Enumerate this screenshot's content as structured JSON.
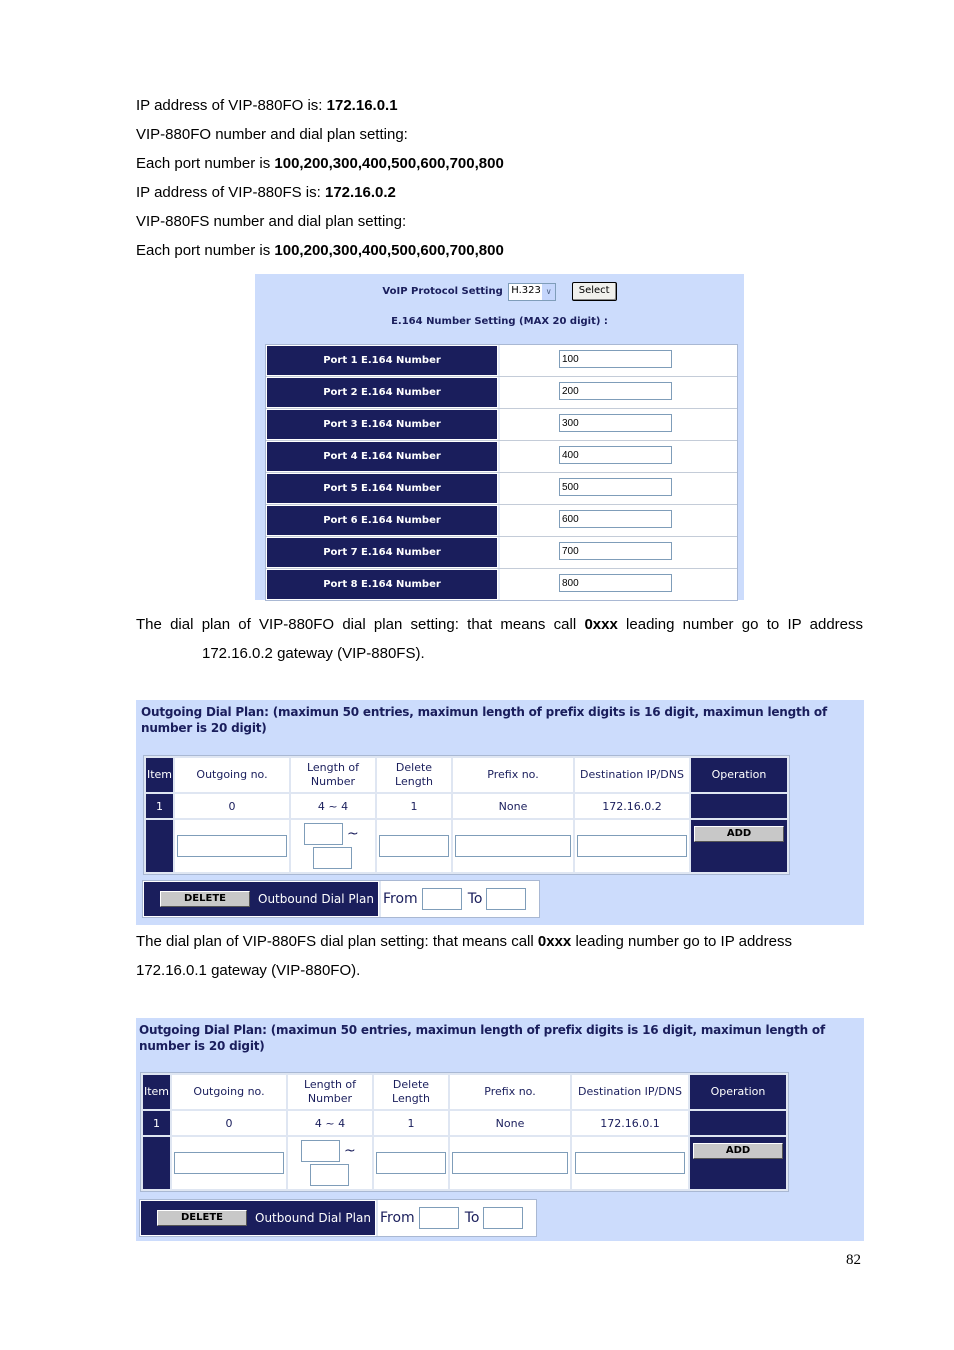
{
  "intro": [
    {
      "text": "IP address of VIP-880FO is: ",
      "bold": "172.16.0.1"
    },
    {
      "text": "VIP-880FO number and dial plan setting:",
      "bold": ""
    },
    {
      "text": "Each port number is ",
      "bold": "100,200,300,400,500,600,700,800"
    },
    {
      "text": "IP address of VIP-880FS is: ",
      "bold": "172.16.0.2"
    },
    {
      "text": "VIP-880FS number and dial plan setting:",
      "bold": ""
    },
    {
      "text": "Each port number is ",
      "bold": "100,200,300,400,500,600,700,800"
    }
  ],
  "voip_panel": {
    "protocol_label": "VoIP Protocol Setting",
    "protocol_value": "H.323",
    "select_button": "Select",
    "e164_title": "E.164 Number Setting (MAX 20 digit) :",
    "ports": [
      {
        "label": "Port 1 E.164 Number",
        "value": "100"
      },
      {
        "label": "Port 2 E.164 Number",
        "value": "200"
      },
      {
        "label": "Port 3 E.164 Number",
        "value": "300"
      },
      {
        "label": "Port 4 E.164 Number",
        "value": "400"
      },
      {
        "label": "Port 5 E.164 Number",
        "value": "500"
      },
      {
        "label": "Port 6 E.164 Number",
        "value": "600"
      },
      {
        "label": "Port 7 E.164 Number",
        "value": "700"
      },
      {
        "label": "Port 8 E.164 Number",
        "value": "800"
      }
    ]
  },
  "para1": {
    "before": "The dial plan of VIP-880FO dial plan setting: that means call ",
    "bold": "0xxx",
    "after": " leading number go to IP address",
    "line2": "172.16.0.2 gateway (VIP-880FS)."
  },
  "para2": {
    "before": "The dial plan of VIP-880FS dial plan setting: that means call ",
    "bold": "0xxx",
    "after": " leading number go to IP address",
    "line2": "172.16.0.1 gateway (VIP-880FO)."
  },
  "dialplans": [
    {
      "title": "Outgoing Dial Plan: (maximun 50 entries, maximun length of prefix digits is 16 digit, maximun length of number is 20 digit)",
      "headers": [
        "Item",
        "Outgoing no.",
        "Length of Number",
        "Delete Length",
        "Prefix no.",
        "Destination IP/DNS",
        "Operation"
      ],
      "row": {
        "item": "1",
        "outgoing": "0",
        "length": "4 ~ 4",
        "delete": "1",
        "prefix": "None",
        "dest": "172.16.0.2"
      },
      "tilde": "~",
      "add_button": "ADD",
      "delete_button": "DELETE",
      "outbound_label": "Outbound Dial Plan",
      "from_label": "From",
      "to_label": "To"
    },
    {
      "title": "Outgoing Dial Plan: (maximun 50 entries, maximun length of prefix digits is 16 digit, maximun length of number is 20 digit)",
      "headers": [
        "Item",
        "Outgoing no.",
        "Length of Number",
        "Delete Length",
        "Prefix no.",
        "Destination IP/DNS",
        "Operation"
      ],
      "row": {
        "item": "1",
        "outgoing": "0",
        "length": "4 ~ 4",
        "delete": "1",
        "prefix": "None",
        "dest": "172.16.0.1"
      },
      "tilde": "~",
      "add_button": "ADD",
      "delete_button": "DELETE",
      "outbound_label": "Outbound Dial Plan",
      "from_label": "From",
      "to_label": "To"
    }
  ],
  "page_number": "82"
}
